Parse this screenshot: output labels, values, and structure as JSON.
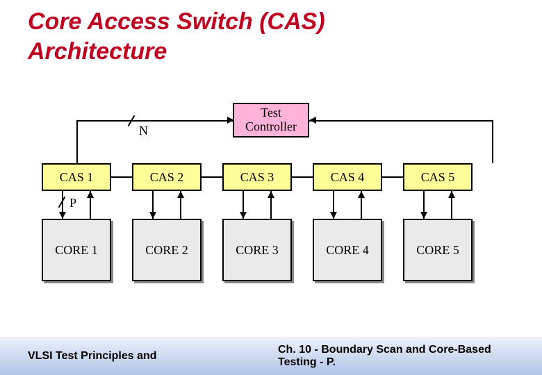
{
  "title_line1": "Core Access Switch (CAS)",
  "title_line2": "Architecture",
  "controller_label": "Test Controller",
  "labels": {
    "N": "N",
    "P": "P"
  },
  "cas_boxes": [
    "CAS 1",
    "CAS 2",
    "CAS 3",
    "CAS 4",
    "CAS 5"
  ],
  "core_boxes": [
    "CORE 1",
    "CORE 2",
    "CORE 3",
    "CORE 4",
    "CORE 5"
  ],
  "footer_left": "VLSI Test Principles and",
  "footer_right": "Ch. 10 - Boundary Scan and Core-Based Testing - P.",
  "colors": {
    "title": "#c00020",
    "cas": "#ffff99",
    "core": "#eaeaea",
    "ctrl": "#ffb3d9"
  }
}
